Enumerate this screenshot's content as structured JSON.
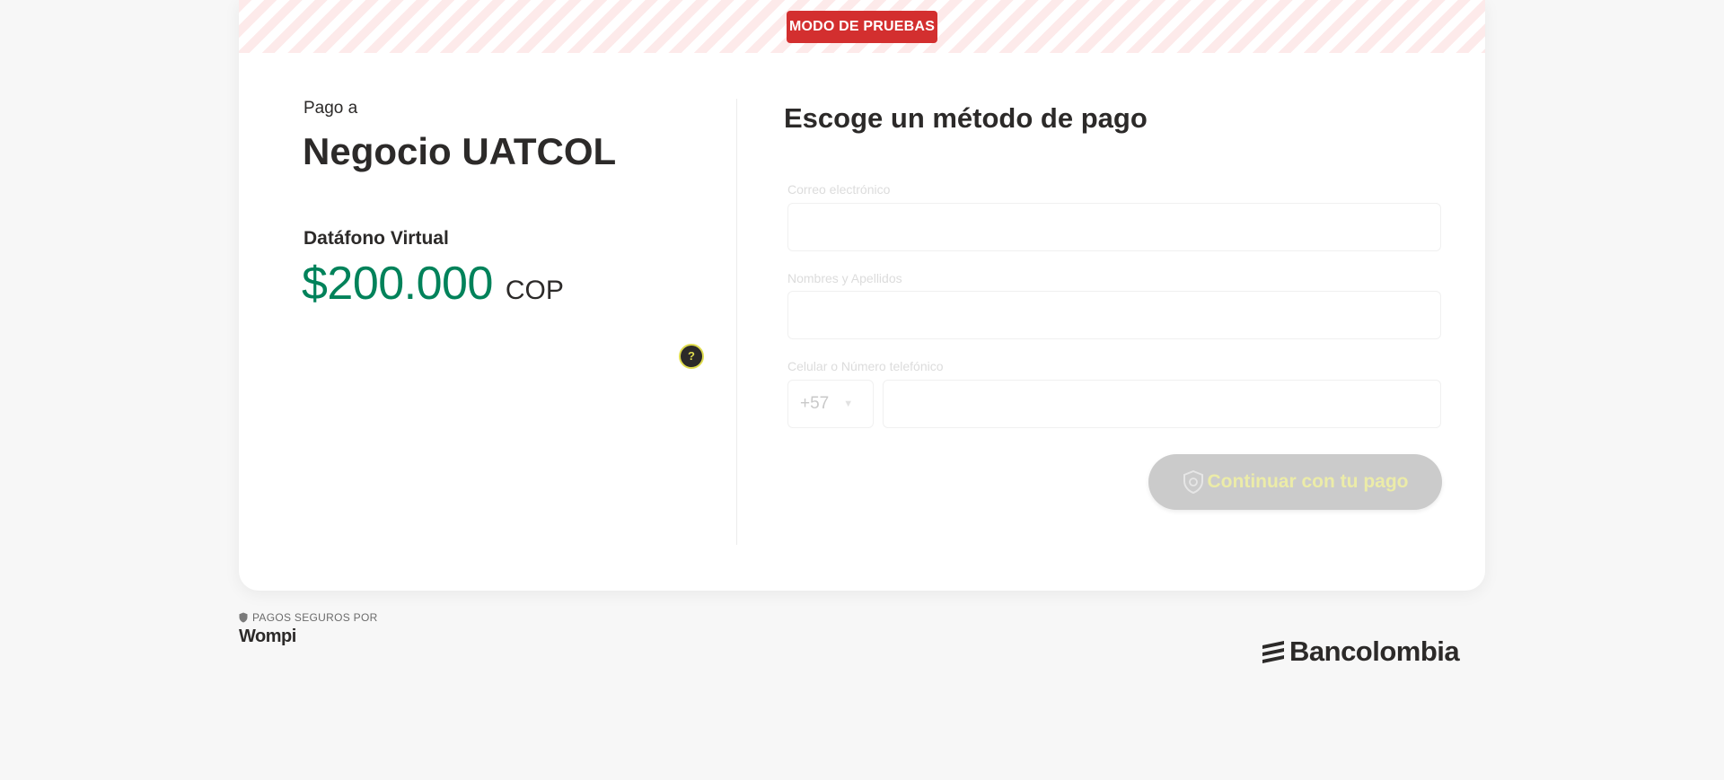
{
  "banner": {
    "badge": "MODO DE PRUEBAS",
    "badge_color": "#d32f2f"
  },
  "summary": {
    "pay_to_label": "Pago a",
    "merchant_name": "Negocio UATCOL",
    "product_name": "Datáfono Virtual",
    "amount": "$200.000",
    "currency": "COP",
    "amount_color": "#00825a",
    "help_icon": "question-icon",
    "help_symbol": "?"
  },
  "form": {
    "title": "Escoge un método de pago",
    "email_label": "Correo electrónico",
    "email_value": "",
    "name_label": "Nombres y Apellidos",
    "name_value": "",
    "phone_label": "Celular o Número telefónico",
    "phone_prefix": "+57",
    "phone_value": "",
    "continue_label": "Continuar con tu pago",
    "continue_icon": "shield-icon"
  },
  "footer": {
    "secure_label": "PAGOS SEGUROS POR",
    "provider": "Wompi",
    "bank": "Bancolombia"
  }
}
